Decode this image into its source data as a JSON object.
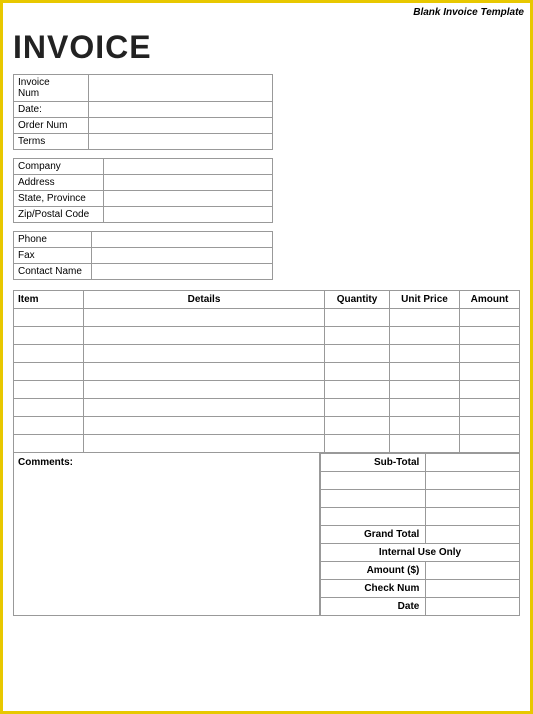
{
  "template_label": "Blank Invoice Template",
  "invoice_title": "INVOICE",
  "top_fields": [
    {
      "label": "Invoice\nNum",
      "value": ""
    },
    {
      "label": "Date:",
      "value": ""
    },
    {
      "label": "Order Num",
      "value": ""
    },
    {
      "label": "Terms",
      "value": ""
    }
  ],
  "address_fields": [
    {
      "label": "Company",
      "value": ""
    },
    {
      "label": "Address",
      "value": ""
    },
    {
      "label": "State, Province",
      "value": ""
    },
    {
      "label": "Zip/Postal Code",
      "value": ""
    }
  ],
  "contact_fields": [
    {
      "label": "Phone",
      "value": ""
    },
    {
      "label": "Fax",
      "value": ""
    },
    {
      "label": "Contact Name",
      "value": ""
    }
  ],
  "table_headers": {
    "item": "Item",
    "details": "Details",
    "quantity": "Quantity",
    "unit_price": "Unit Price",
    "amount": "Amount"
  },
  "table_rows": 8,
  "comments_label": "Comments:",
  "totals": {
    "sub_total": "Sub-Total",
    "blank1": "",
    "blank2": "",
    "blank3": "",
    "grand_total": "Grand Total",
    "internal_use": "Internal Use Only",
    "amount_label": "Amount ($)",
    "check_num_label": "Check Num",
    "date_label": "Date"
  }
}
